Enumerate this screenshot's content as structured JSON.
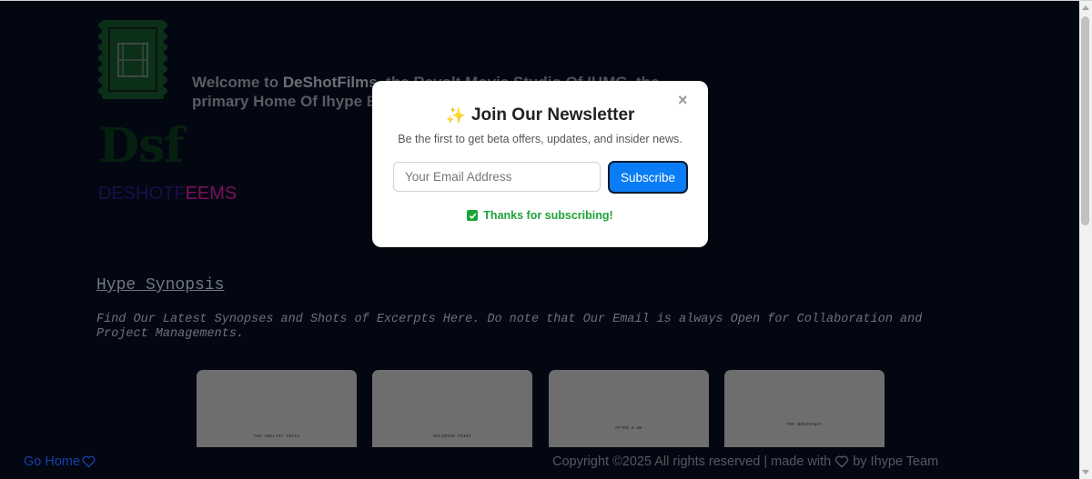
{
  "header": {
    "logo_mark": "Dsf",
    "logo_sub_a": "DESHOTF",
    "logo_sub_b": "EEMS",
    "welcome_prefix": "Welcome to ",
    "welcome_brand": "DeShotFilms",
    "welcome_rest": ", the Revolt Movie Studio Of IHMG, the primary Home Of Ihype En"
  },
  "section": {
    "title": "Hype Synopsis",
    "description": "Find Our Latest Synopses and Shots of Excerpts Here. Do note that Our Email is always Open for Collaboration and Project Managements."
  },
  "cards": [
    {
      "text": "THE ANALYST TRAIL"
    },
    {
      "text": "SPLINTER POINT"
    },
    {
      "text": "AFTER & WE"
    },
    {
      "text": "THE BREAKAWAY"
    }
  ],
  "footer": {
    "go_home": "Go Home",
    "copyright_text": "Copyright ©2025 All rights reserved | made with",
    "copyright_by": "by Ihype Team"
  },
  "modal": {
    "title": "Join Our Newsletter",
    "subtitle": "Be the first to get beta offers, updates, and insider news.",
    "email_placeholder": "Your Email Address",
    "subscribe_label": "Subscribe",
    "success_message": "Thanks for subscribing!",
    "close_symbol": "×"
  },
  "colors": {
    "background": "#020712",
    "accent_blue": "#0a7cf5",
    "success_green": "#1ea33a"
  }
}
